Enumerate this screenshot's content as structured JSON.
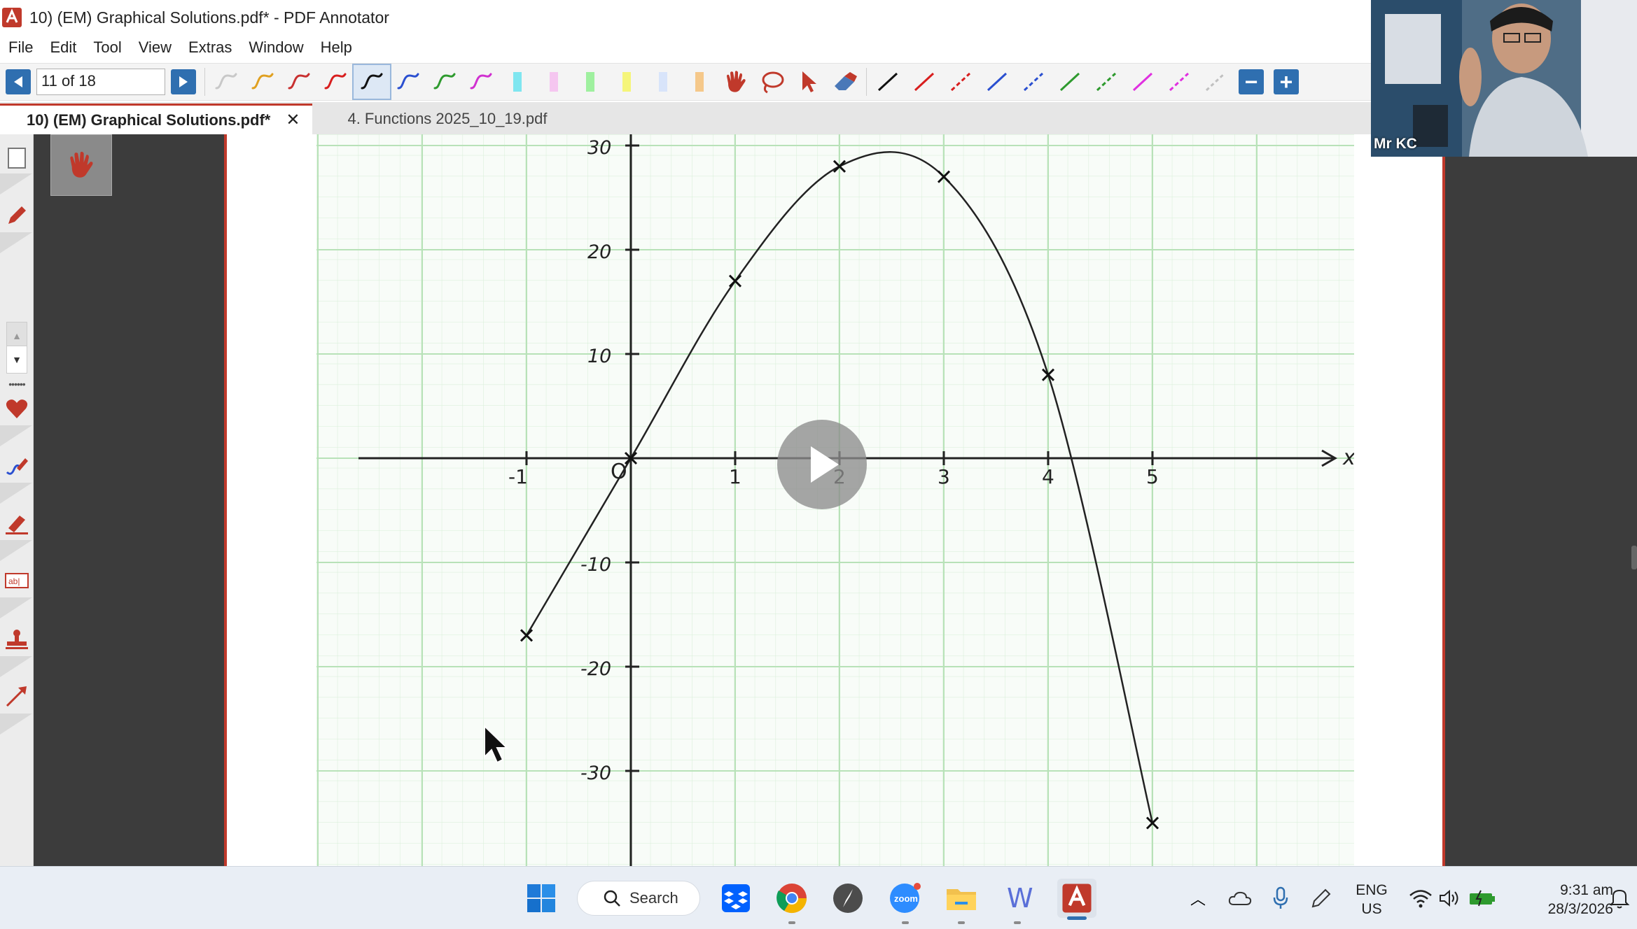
{
  "window": {
    "title": "10) (EM) Graphical Solutions.pdf* - PDF Annotator"
  },
  "menu": {
    "items": [
      "File",
      "Edit",
      "Tool",
      "View",
      "Extras",
      "Window",
      "Help"
    ]
  },
  "toolbar": {
    "page_indicator": "11 of 18",
    "pen_colors": [
      "#c8c8c8",
      "#e0a020",
      "#c83030",
      "#d81e1e",
      "#111111",
      "#2a4fd0",
      "#2e9a2e",
      "#d030d0"
    ],
    "highlighter_colors": [
      "#7fe6f0",
      "#f5c6f0",
      "#9ff09f",
      "#f5f57a",
      "#d8e4fa",
      "#f5c88a"
    ],
    "line_colors": [
      "#111111",
      "#d81e1e",
      "#d81e1e",
      "#2a4fd0",
      "#2a4fd0",
      "#2e9a2e",
      "#2e9a2e",
      "#e030e0",
      "#e030e0",
      "#c0c0c0"
    ]
  },
  "tabs": [
    {
      "label": "10) (EM) Graphical Solutions.pdf*",
      "active": true
    },
    {
      "label": "4. Functions 2025_10_19.pdf",
      "active": false
    }
  ],
  "graph": {
    "x_axis_label": "x",
    "origin_label": "O",
    "x_tick_labels": [
      "-1",
      "1",
      "2",
      "3",
      "4",
      "5"
    ],
    "y_tick_labels": [
      "30",
      "20",
      "10",
      "-10",
      "-20",
      "-30"
    ],
    "plotted_points": [
      {
        "x": -1,
        "y": -17
      },
      {
        "x": 0,
        "y": 0
      },
      {
        "x": 1,
        "y": 17
      },
      {
        "x": 2,
        "y": 28
      },
      {
        "x": 3,
        "y": 27
      },
      {
        "x": 4,
        "y": 8
      },
      {
        "x": 5,
        "y": -35
      }
    ]
  },
  "webcam": {
    "name_label": "Mr KC"
  },
  "taskbar": {
    "search_label": "Search",
    "language_top": "ENG",
    "language_bottom": "US",
    "time": "9:31 am",
    "date": "28/3/2026"
  }
}
